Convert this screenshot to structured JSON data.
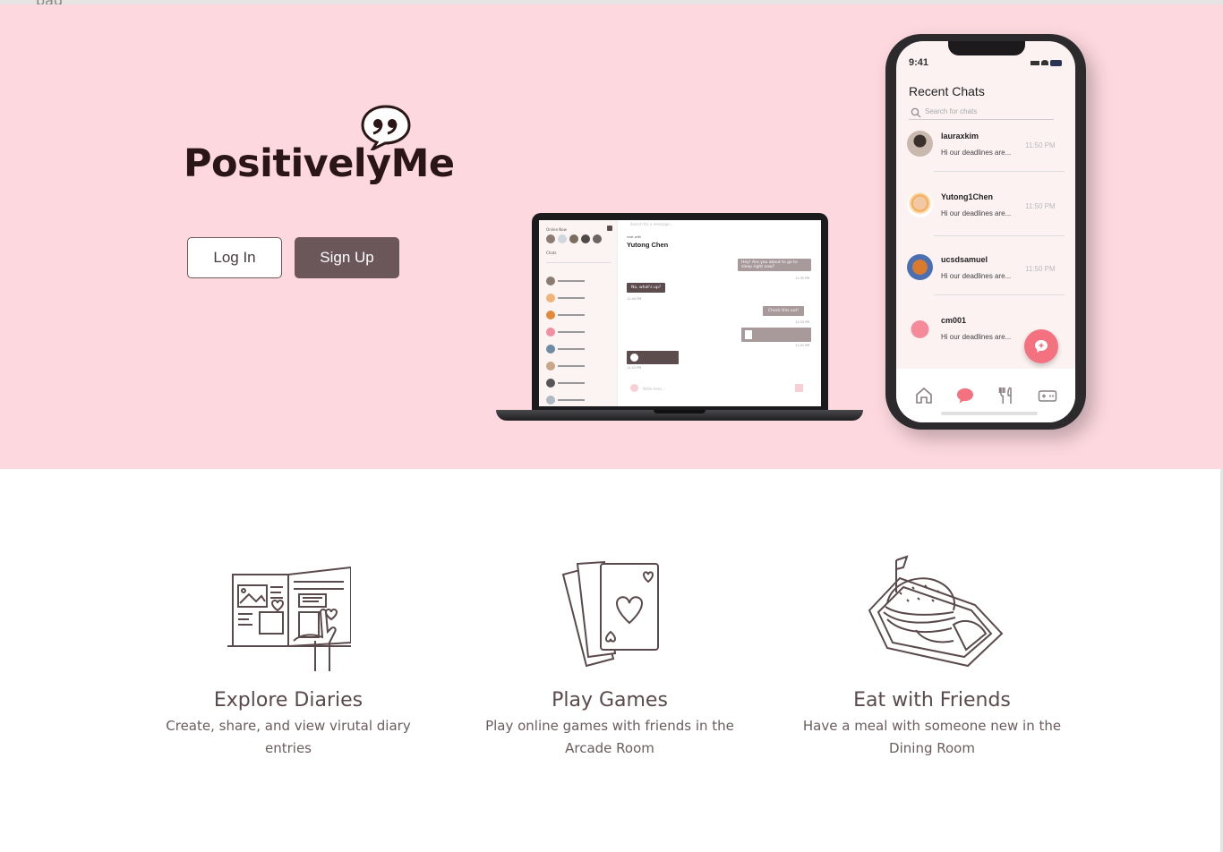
{
  "brand": {
    "name": "PositivelyMe"
  },
  "top_strip": {
    "text": "pag"
  },
  "auth": {
    "login_label": "Log In",
    "signup_label": "Sign Up"
  },
  "laptop": {
    "online_label": "Online Now",
    "chats_label": "Chats",
    "search_placeholder": "Search for a message...",
    "chat_with_label": "chat with",
    "chat_with_name": "Yutong Chen",
    "messages": [
      "Hey! Are you about to go to sleep right now?",
      "No, what's up?",
      "Check this out!"
    ],
    "times": [
      "11:30 PM",
      "11:40 PM",
      "11:32 PM",
      "11:41 PM",
      "11:23 PM"
    ],
    "type_placeholder": "Write here..."
  },
  "phone": {
    "time": "9:41",
    "title": "Recent Chats",
    "search_placeholder": "Search for chats",
    "chats": [
      {
        "name": "lauraxkim",
        "message": "Hi our deadlines are...",
        "time": "11:50 PM"
      },
      {
        "name": "Yutong1Chen",
        "message": "Hi our deadlines are...",
        "time": "11:50 PM"
      },
      {
        "name": "ucsdsamuel",
        "message": "Hi our deadlines are...",
        "time": "11:50 PM"
      },
      {
        "name": "cm001",
        "message": "Hi our deadlines are...",
        "time": ""
      }
    ]
  },
  "features": [
    {
      "title": "Explore Diaries",
      "desc": "Create, share, and view virutal diary entries",
      "icon": "diary-icon"
    },
    {
      "title": "Play Games",
      "desc": "Play online games with friends in the Arcade Room",
      "icon": "cards-icon"
    },
    {
      "title": "Eat with Friends",
      "desc": "Have a meal with someone new in the Dining Room",
      "icon": "burger-icon"
    }
  ],
  "colors": {
    "hero_bg": "#fdd8df",
    "accent": "#6b5759",
    "fab": "#f4727f"
  }
}
